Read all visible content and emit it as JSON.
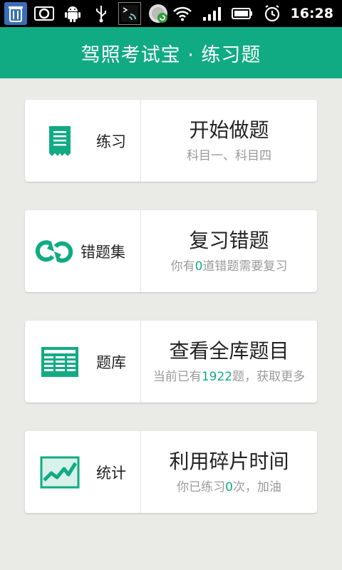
{
  "statusbar": {
    "time": "16:28",
    "icons": [
      "trash-icon",
      "camera-icon",
      "android-icon",
      "usb-icon",
      "terminal-icon",
      "sync-icon",
      "wifi-icon",
      "signal-icon",
      "battery-icon",
      "alarm-icon"
    ]
  },
  "header": {
    "title": "驾照考试宝 · 练习题"
  },
  "accent_color": "#11ab83",
  "cards": [
    {
      "label": "练习",
      "icon": "receipt-icon",
      "title": "开始做题",
      "subtitle": "科目一、科目四"
    },
    {
      "label": "错题集",
      "icon": "loop-icon",
      "title": "复习错题",
      "subtitle_pre": "你有",
      "subtitle_num": "0",
      "subtitle_post": "道错题需要复习"
    },
    {
      "label": "题库",
      "icon": "newspaper-icon",
      "title": "查看全库题目",
      "subtitle_pre": "当前已有",
      "subtitle_num": "1922",
      "subtitle_post": "题，获取更多"
    },
    {
      "label": "统计",
      "icon": "line-chart-icon",
      "title": "利用碎片时间",
      "subtitle_pre": "你已练习",
      "subtitle_num": "0",
      "subtitle_post": "次，加油"
    }
  ]
}
